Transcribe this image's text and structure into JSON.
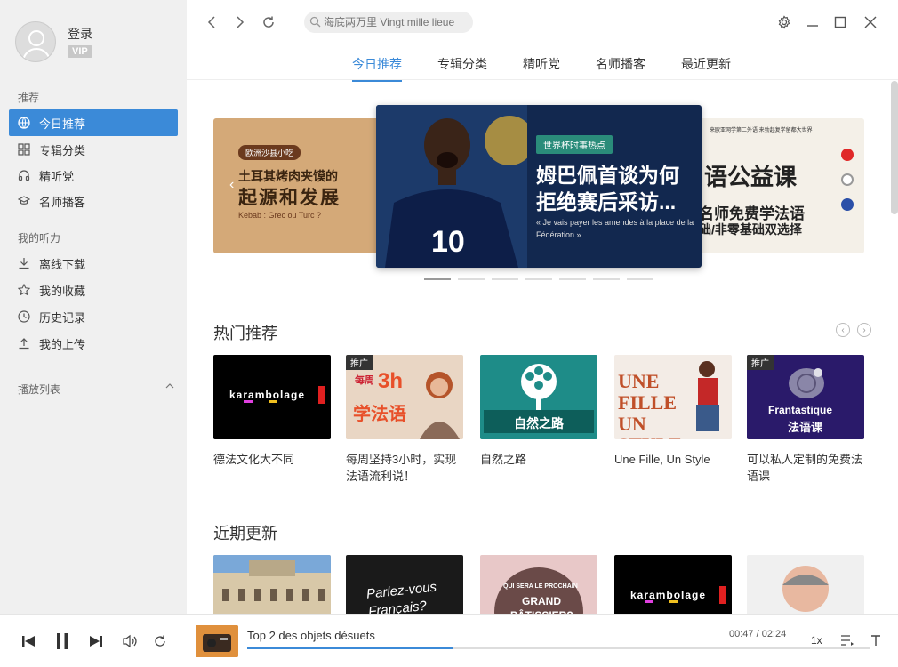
{
  "user": {
    "login_label": "登录",
    "vip_label": "VIP"
  },
  "sidebar": {
    "section_recommend": "推荐",
    "items_recommend": [
      {
        "label": "今日推荐",
        "icon": "globe-icon"
      },
      {
        "label": "专辑分类",
        "icon": "grid-icon"
      },
      {
        "label": "精听党",
        "icon": "headphones-icon"
      },
      {
        "label": "名师播客",
        "icon": "graduation-cap-icon"
      }
    ],
    "section_mine": "我的听力",
    "items_mine": [
      {
        "label": "离线下载",
        "icon": "download-icon"
      },
      {
        "label": "我的收藏",
        "icon": "star-icon"
      },
      {
        "label": "历史记录",
        "icon": "clock-icon"
      },
      {
        "label": "我的上传",
        "icon": "upload-icon"
      }
    ],
    "section_playlist": "播放列表"
  },
  "search": {
    "placeholder": "海底两万里 Vingt mille lieue"
  },
  "tabs": [
    "今日推荐",
    "专辑分类",
    "精听党",
    "名师播客",
    "最近更新"
  ],
  "banners": {
    "left": {
      "tag": "欧洲沙县小吃",
      "line1": "土耳其烤肉夹馍的",
      "line2": "起源和发展",
      "line3": "Kebab : Grec ou Turc ?"
    },
    "center": {
      "tag": "世界杯时事热点",
      "line1": "姆巴佩首谈为何",
      "line2": "拒绝赛后采访...",
      "line3": "« Je vais payer les amendes à la place de la Fédération »"
    },
    "right": {
      "line0": "来欧亚网学第二外语 来勃起复学留都大世界",
      "line1": "语公益课",
      "line2": "名师免费学法语",
      "line3": "础/非零基础双选择"
    }
  },
  "hot": {
    "title": "热门推荐",
    "cards": [
      {
        "title": "德法文化大不同",
        "thumb_text": "karambolage",
        "promo": ""
      },
      {
        "title": "每周坚持3小时，实现法语流利说！",
        "thumb_text": "学法语",
        "thumb_sub": "每周",
        "thumb_big": "3h",
        "promo": "推广"
      },
      {
        "title": "自然之路",
        "thumb_text": "自然之路",
        "promo": ""
      },
      {
        "title": "Une Fille, Un Style",
        "thumb_text": "UNE FILLE UN STYLE",
        "promo": ""
      },
      {
        "title": "可以私人定制的免费法语课",
        "thumb_text": "Frantastique",
        "thumb_sub": "法语课",
        "promo": "推广"
      }
    ]
  },
  "recent": {
    "title": "近期更新",
    "cards": [
      {
        "thumb_text": ""
      },
      {
        "thumb_text": "Parlez-vous Français?"
      },
      {
        "thumb_text": "GRAND PÂTISSIER?",
        "thumb_sub": "QUI SERA LE PROCHAIN"
      },
      {
        "thumb_text": "karambolage"
      },
      {
        "thumb_text": ""
      }
    ]
  },
  "player": {
    "title": "Top 2 des objets désuets",
    "time": "00:47 / 02:24",
    "progress": 0.33,
    "speed": "1x"
  },
  "colors": {
    "accent": "#3b8ad8",
    "sidebar_bg": "#f0f0f0"
  }
}
